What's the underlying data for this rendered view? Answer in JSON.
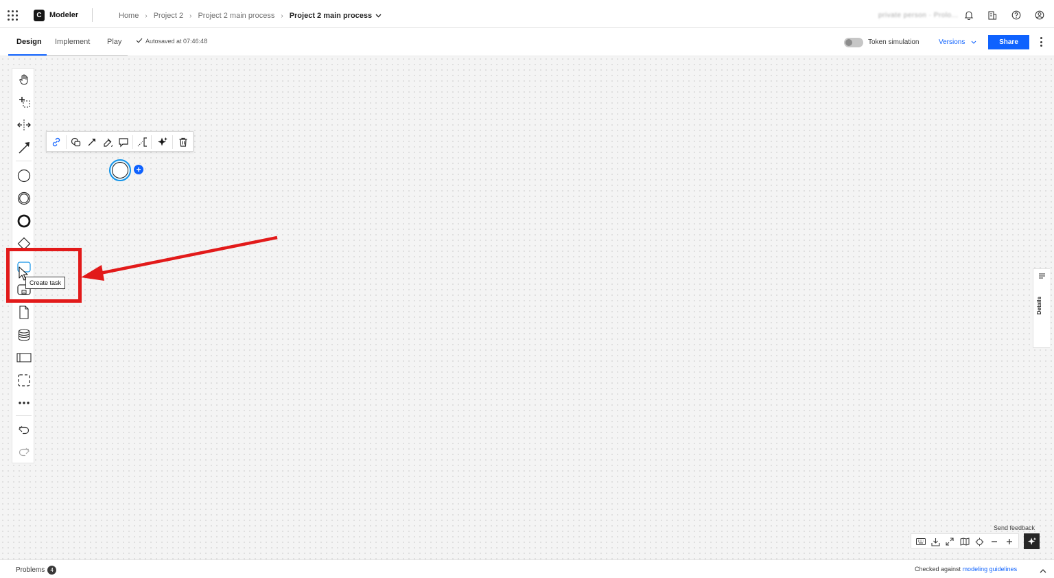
{
  "header": {
    "app_name": "Modeler",
    "logo_letter": "C",
    "breadcrumb": [
      "Home",
      "Project 2",
      "Project 2 main process"
    ],
    "breadcrumb_current": "Project 2 main process",
    "user_name": "private person · Prolo..."
  },
  "subbar": {
    "tabs": [
      "Design",
      "Implement",
      "Play"
    ],
    "active_tab": "Design",
    "autosave": "Autosaved at 07:46:48",
    "token_simulation": "Token simulation",
    "versions": "Versions",
    "share": "Share"
  },
  "palette": {
    "items": [
      "hand-tool",
      "lasso-tool",
      "space-tool",
      "connect-tool",
      "start-event",
      "intermediate-event",
      "end-event",
      "gateway",
      "task",
      "subprocess",
      "data-object",
      "data-store",
      "pool",
      "group",
      "more"
    ],
    "tooltip": "Create task"
  },
  "canvas": {
    "append_symbol": "+"
  },
  "details_panel": {
    "label": "Details"
  },
  "bottom": {
    "send_feedback": "Send feedback",
    "problems_label": "Problems",
    "problems_count": "4",
    "checked_prefix": "Checked against",
    "checked_link": "modeling guidelines"
  },
  "colors": {
    "accent": "#0f62fe",
    "annotation": "#e21a1a",
    "selection": "#1192e8"
  }
}
